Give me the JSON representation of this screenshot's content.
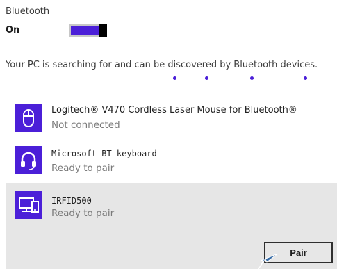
{
  "bluetooth": {
    "label": "Bluetooth",
    "state": "On",
    "toggle_on": true
  },
  "status_text": "Your PC is searching for and can be discovered by Bluetooth devices.",
  "accent_color": "#4b1fd8",
  "devices": [
    {
      "name": "Logitech® V470 Cordless Laser Mouse for Bluetooth®",
      "status": "Not connected",
      "icon": "mouse-icon"
    },
    {
      "name": "Microsoft BT keyboard",
      "status": "Ready to pair",
      "icon": "headset-icon"
    },
    {
      "name": "IRFID500",
      "status": "Ready to pair",
      "icon": "computer-device-icon",
      "selected": true
    }
  ],
  "pair_button": {
    "label": "Pair"
  }
}
